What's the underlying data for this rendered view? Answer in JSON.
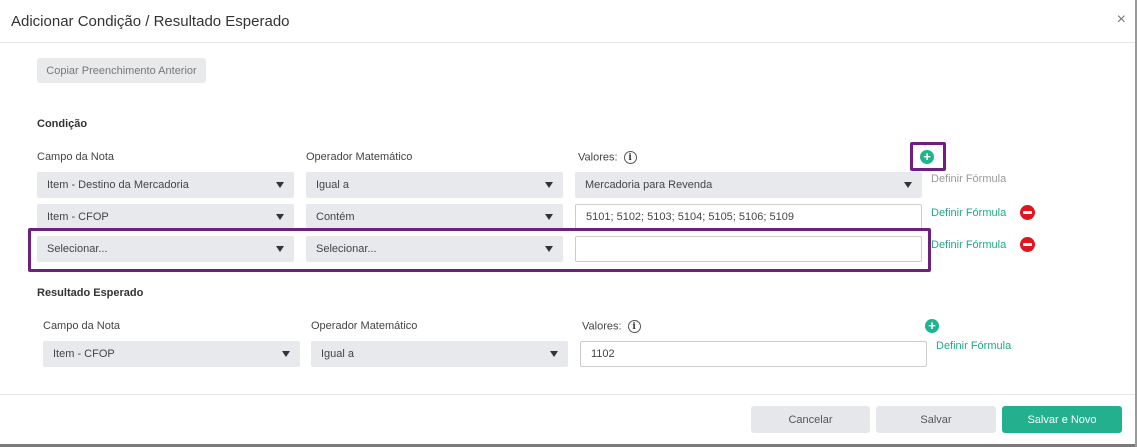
{
  "dialog": {
    "title": "Adicionar Condição / Resultado Esperado",
    "close_glyph": "×"
  },
  "copy_button": "Copiar Preenchimento Anterior",
  "condition": {
    "section_title": "Condição",
    "labels": {
      "field": "Campo da Nota",
      "operator": "Operador Matemático",
      "values": "Valores:"
    },
    "add_glyph": "+",
    "rows": [
      {
        "field": "Item - Destino da Mercadoria",
        "operator": "Igual a",
        "value": "Mercadoria para Revenda",
        "formula_link": "Definir Fórmula"
      },
      {
        "field": "Item - CFOP",
        "operator": "Contém",
        "value": "5101; 5102; 5103; 5104; 5105; 5106; 5109",
        "formula_link": "Definir Fórmula"
      },
      {
        "field": "Selecionar...",
        "operator": "Selecionar...",
        "value": "",
        "formula_link": "Definir Fórmula"
      }
    ]
  },
  "expected_result": {
    "section_title": "Resultado Esperado",
    "labels": {
      "field": "Campo da Nota",
      "operator": "Operador Matemático",
      "values": "Valores:"
    },
    "add_glyph": "+",
    "row": {
      "field": "Item - CFOP",
      "operator": "Igual a",
      "value": "1102",
      "formula_link": "Definir Fórmula"
    }
  },
  "info_glyph": "i",
  "footer": {
    "cancel": "Cancelar",
    "save": "Salvar",
    "save_new": "Salvar e Novo"
  },
  "colors": {
    "accent_green": "#22b08f",
    "remove_red": "#e3141a",
    "highlight_purple": "#6f1f80"
  }
}
